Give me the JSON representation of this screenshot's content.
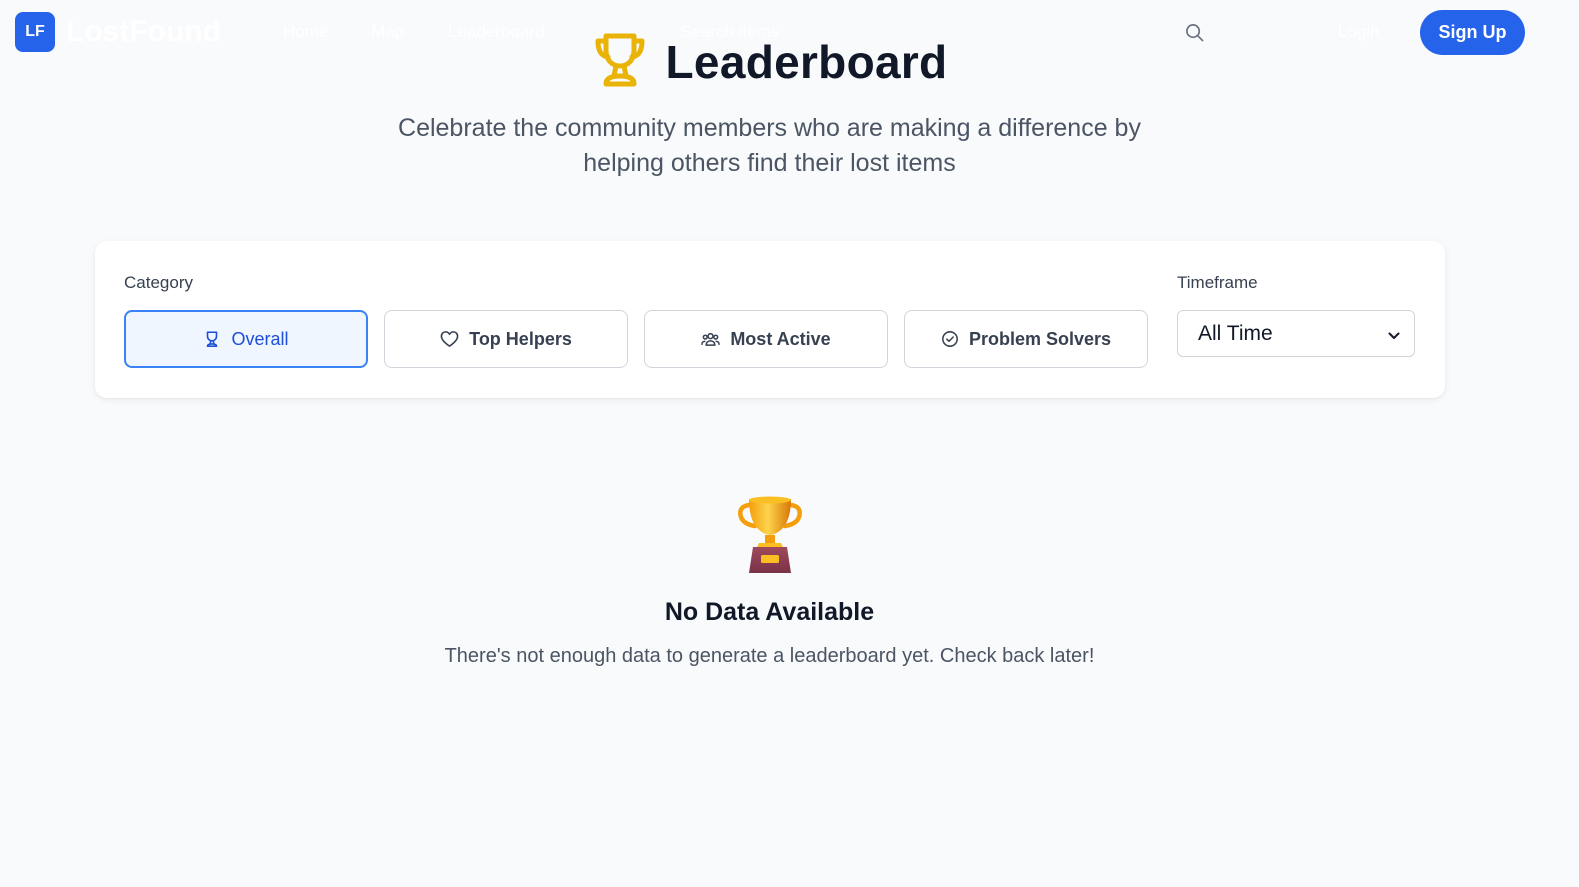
{
  "colors": {
    "primary": "#2563eb",
    "trophy_gold": "#eab308",
    "page_bg": "#f8fafc"
  },
  "navbar": {
    "logo_badge": "LF",
    "brand": "LostFound",
    "links": [
      "Home",
      "Map",
      "Leaderboard"
    ],
    "search_text": "Search items",
    "search_icon": "search-icon",
    "login_label": "Login",
    "signup_label": "Sign Up"
  },
  "hero": {
    "icon": "trophy-icon",
    "title": "Leaderboard",
    "subtitle_line1": "Celebrate the community members who are making a difference by",
    "subtitle_line2": "helping others find their lost items"
  },
  "filters": {
    "category_label": "Category",
    "categories": [
      {
        "label": "Overall",
        "icon": "trophy-icon",
        "active": true
      },
      {
        "label": "Top Helpers",
        "icon": "heart-icon",
        "active": false
      },
      {
        "label": "Most Active",
        "icon": "users-icon",
        "active": false
      },
      {
        "label": "Problem Solvers",
        "icon": "check-circle-icon",
        "active": false
      }
    ],
    "timeframe_label": "Timeframe",
    "timeframe_selected": "All Time"
  },
  "empty_state": {
    "icon": "trophy-emoji",
    "title": "No Data Available",
    "message": "There's not enough data to generate a leaderboard yet. Check back later!"
  }
}
